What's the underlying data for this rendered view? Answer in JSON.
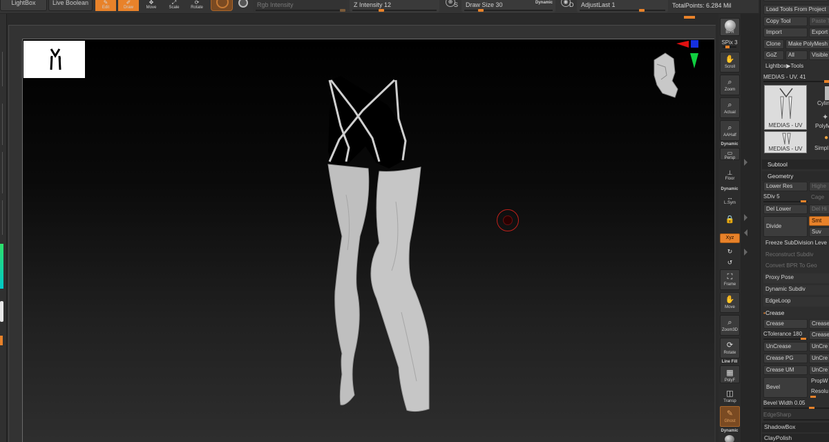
{
  "top": {
    "lightbox": "LightBox",
    "live_boolean": "Live Boolean",
    "edit": "Edit",
    "draw": "Draw",
    "move": "Move",
    "scale": "Scale",
    "rotate": "Rotate",
    "rgb_intensity": "Rgb Intensity",
    "z_intensity": "Z Intensity 12",
    "s_key": "S",
    "draw_size": "Draw Size 30",
    "dynamic": "Dynamic",
    "d_key": "D",
    "adjust_last": "AdjustLast 1",
    "total_points": "TotalPoints: 6.284 Mil"
  },
  "strip": {
    "bpr": "BPR",
    "spix": "SPix 3",
    "scroll": "Scroll",
    "zoom": "Zoom",
    "actual": "Actual",
    "aahalf": "AAHalf",
    "dynamic1": "Dynamic",
    "persp": "Persp",
    "floor": "Floor",
    "dynamic2": "Dynamic",
    "lsym": "L.Sym",
    "xyz": "Xyz",
    "frame": "Frame",
    "move": "Move",
    "zoom3d": "Zoom3D",
    "rotate": "Rotate",
    "linefill": "Line Fill",
    "polyf": "PolyF",
    "transp": "Transp",
    "ghost": "Ghost",
    "dynamic3": "Dynamic"
  },
  "panel": {
    "load_tools": "Load Tools From Project",
    "copy_tool": "Copy Tool",
    "paste_tool": "Paste T",
    "import": "Import",
    "export": "Export",
    "clone": "Clone",
    "make_polymesh": "Make PolyMesh",
    "goz": "GoZ",
    "all": "All",
    "visible": "Visible",
    "lightbox_tools": "Lightbox▶Tools",
    "current_tool": "MEDIAS - UV. 41",
    "thumb1": "MEDIAS - UV",
    "thumb2": "Cylin",
    "thumb3": "PolyM",
    "thumb4": "MEDIAS - UV",
    "thumb5": "Simpl",
    "subtool": "Subtool",
    "geometry": "Geometry",
    "lower_res": "Lower Res",
    "higher": "Highe",
    "sdiv": "SDiv 5",
    "cage": "Cage",
    "del_lower": "Del Lower",
    "del_higher": "Del Hi",
    "divide": "Divide",
    "smt": "Smt",
    "suv": "Suv",
    "freeze": "Freeze SubDivision Leve",
    "reconstruct": "Reconstruct Subdiv",
    "convert_bpr": "Convert BPR To Geo",
    "proxy_pose": "Proxy Pose",
    "dynamic_subdiv": "Dynamic Subdiv",
    "edgeloop": "EdgeLoop",
    "crease_head": "Crease",
    "crease": "Crease",
    "crease2": "Crease",
    "ctolerance": "CTolerance 180",
    "crease3": "Crease",
    "uncrease": "UnCrease",
    "uncrease2": "UnCre",
    "crease_pg": "Crease PG",
    "uncrease3": "UnCre",
    "crease_um": "Crease UM",
    "uncrease4": "UnCre",
    "bevel": "Bevel",
    "propw": "PropW",
    "resolu": "Resolu",
    "bevel_width": "Bevel Width 0.05",
    "edgesharp": "EdgeSharp",
    "shadowbox": "ShadowBox",
    "claypolish": "ClayPolish"
  },
  "colors": {
    "accent": "#e8822a",
    "brush_ring": "#c0201a",
    "mesh": "#bfbfbf"
  }
}
